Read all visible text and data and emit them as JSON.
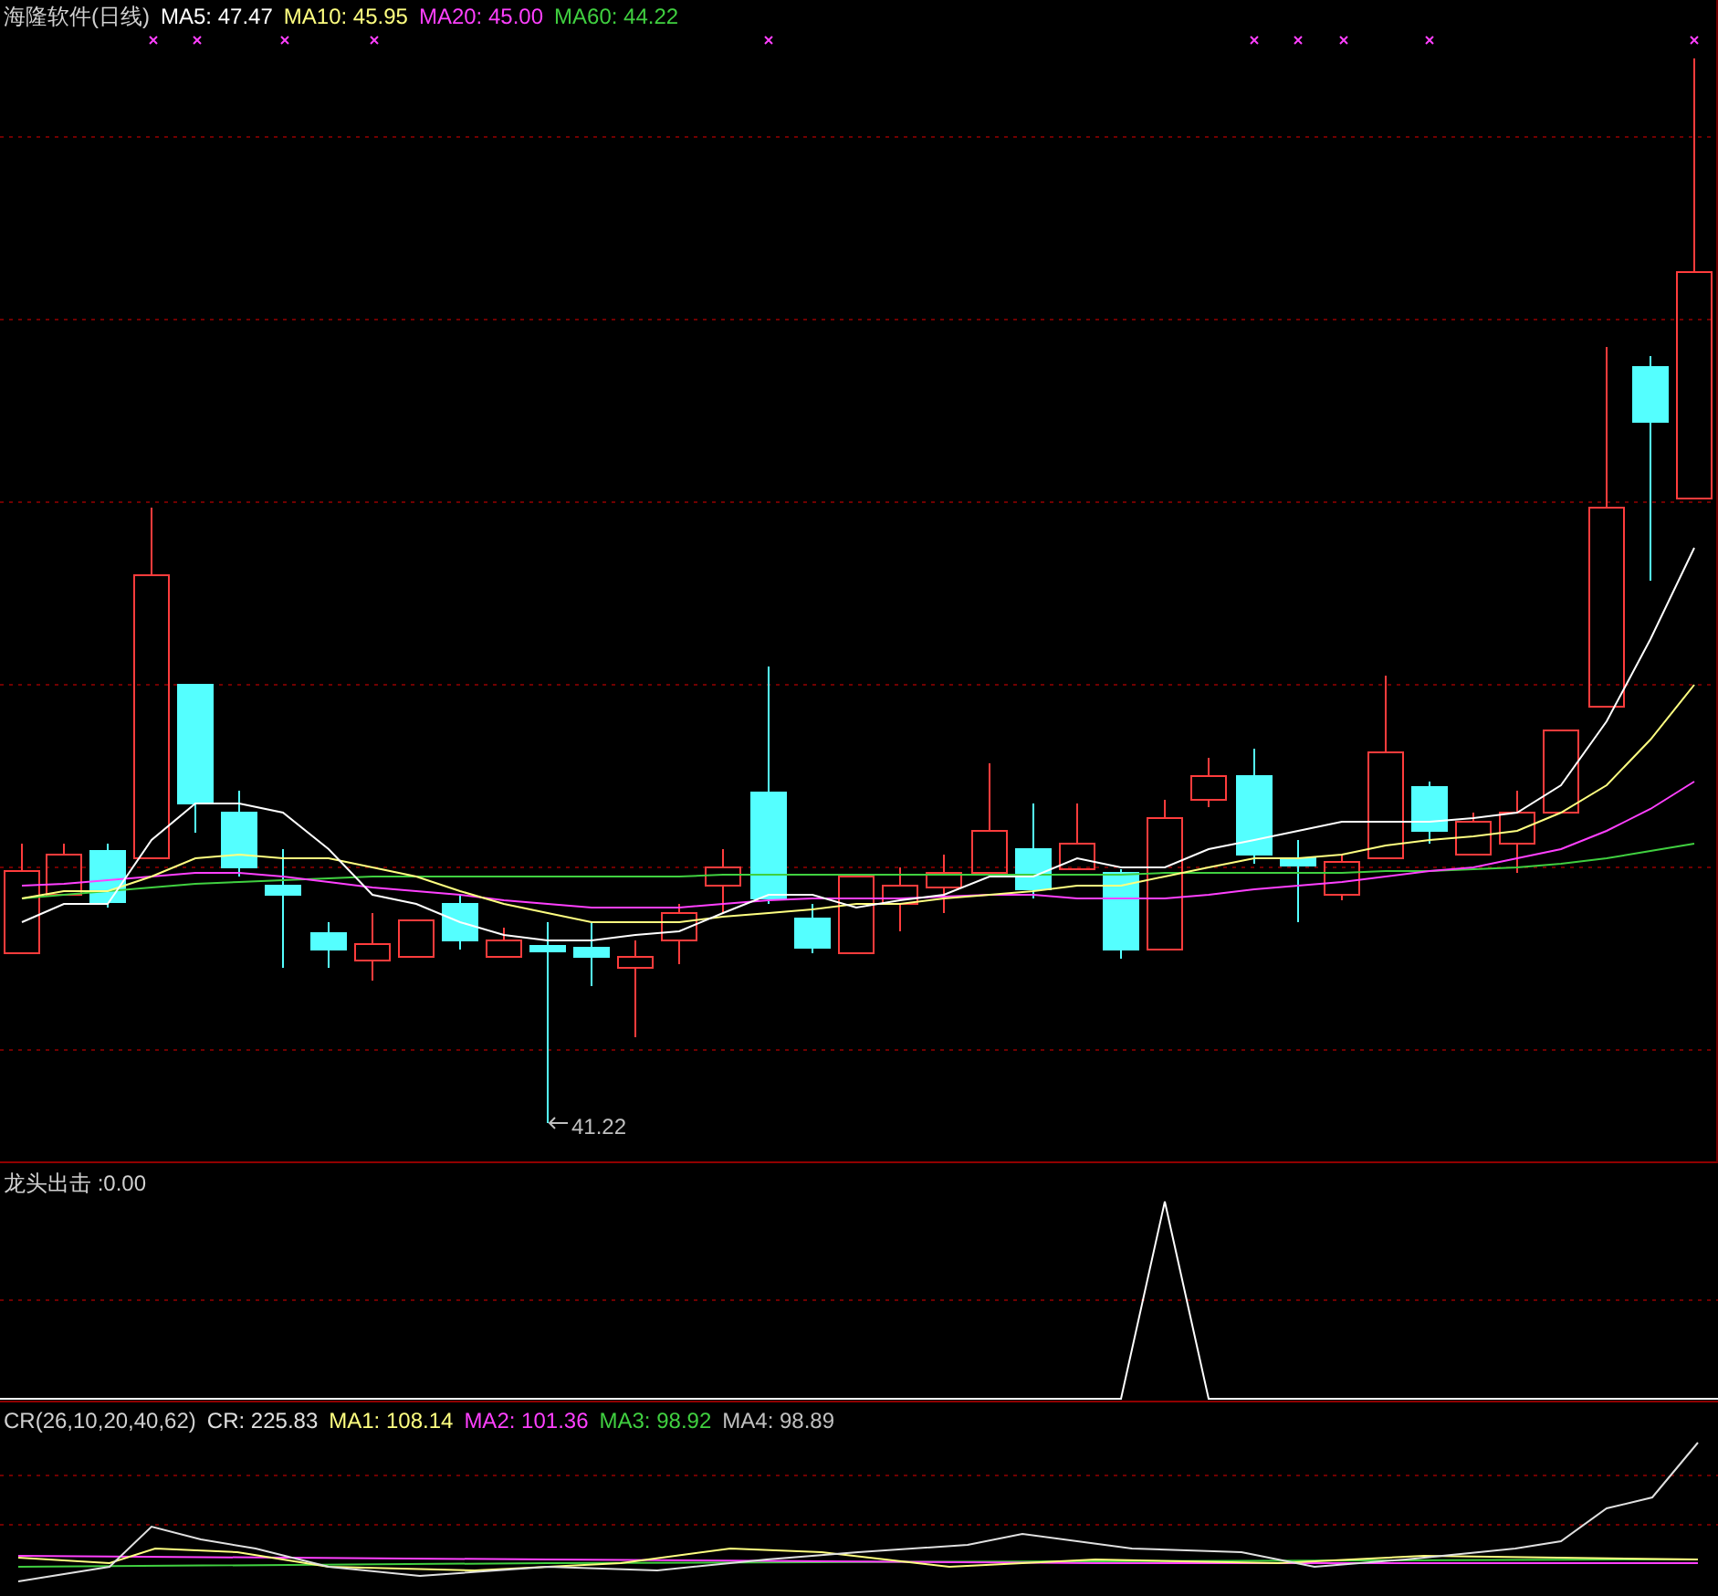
{
  "main_panel": {
    "title": "海隆软件(日线)",
    "legend": [
      {
        "label": "MA5:",
        "value": "47.47",
        "color": "#ffffff"
      },
      {
        "label": "MA10:",
        "value": "45.95",
        "color": "#ffff80"
      },
      {
        "label": "MA20:",
        "value": "45.00",
        "color": "#ff40ff"
      },
      {
        "label": "MA60:",
        "value": "44.22",
        "color": "#40d040"
      }
    ],
    "low_marker": "41.22"
  },
  "indicator_panel": {
    "title": "龙头出击 :0.00"
  },
  "cr_panel": {
    "title": "CR(26,10,20,40,62)",
    "legend": [
      {
        "label": "CR:",
        "value": "225.83",
        "color": "#e0e0e0"
      },
      {
        "label": "MA1:",
        "value": "108.14",
        "color": "#ffff80"
      },
      {
        "label": "MA2:",
        "value": "101.36",
        "color": "#ff40ff"
      },
      {
        "label": "MA3:",
        "value": "98.92",
        "color": "#40d040"
      },
      {
        "label": "MA4:",
        "value": "98.89",
        "color": "#c0c0c0"
      }
    ]
  }
}
